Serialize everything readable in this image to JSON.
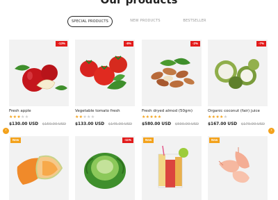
{
  "section": {
    "title": "Our products"
  },
  "tabs": [
    {
      "label": "SPECIAL PRODUCTS",
      "active": true
    },
    {
      "label": "NEW PRODUCTS",
      "active": false
    },
    {
      "label": "BESTSELLER",
      "active": false
    }
  ],
  "colors": {
    "accent": "#f3a21c",
    "sale_badge": "#e21b1b",
    "new_badge": "#f3a21c"
  },
  "products": [
    {
      "name": "Fresh apple",
      "rating": 3,
      "price": "$130.00 USD",
      "old_price": "$150.00 USD",
      "badge": "-13%",
      "icon": "apple-image"
    },
    {
      "name": "Vegetable tomato fresh",
      "rating": 2,
      "price": "$133.00 USD",
      "old_price": "$145.00 USD",
      "badge": "-8%",
      "icon": "tomato-image"
    },
    {
      "name": "Fresh dryed almod (50gm)",
      "rating": 5,
      "price": "$580.00 USD",
      "old_price": "$590.00 USD",
      "badge": "-2%",
      "icon": "almond-image"
    },
    {
      "name": "Organic coconut (fair) juice",
      "rating": 4,
      "price": "$167.00 USD",
      "old_price": "$179.00 USD",
      "badge": "-7%",
      "icon": "coconut-image"
    },
    {
      "badge": "New",
      "icon": "melon-image"
    },
    {
      "badge": "-11%",
      "icon": "cabbage-image"
    },
    {
      "badge": "New",
      "icon": "juice-image"
    },
    {
      "badge": "New",
      "icon": "shrimp-image"
    }
  ],
  "nav": {
    "prev_icon": "chevron-left-icon",
    "next_icon": "chevron-right-icon",
    "prev": "‹",
    "next": "›"
  }
}
